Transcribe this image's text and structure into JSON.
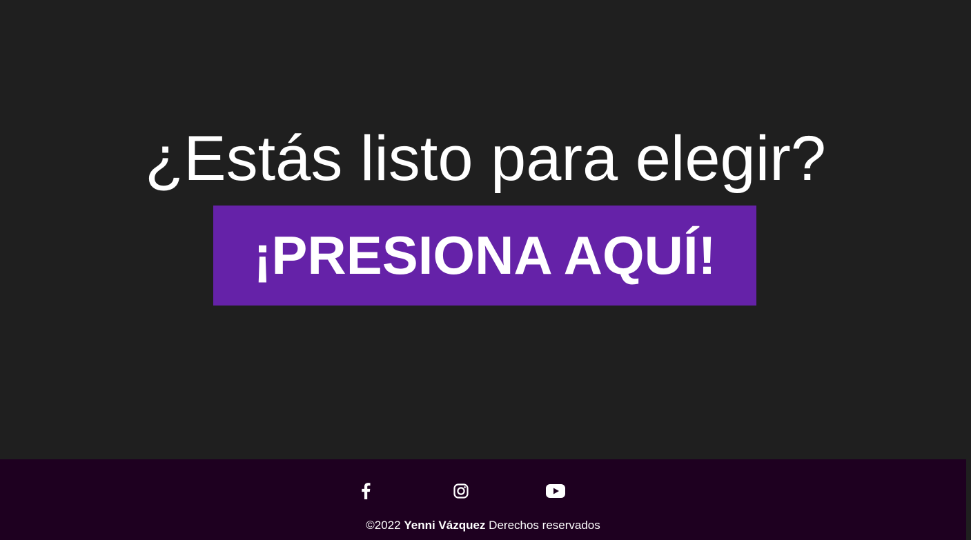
{
  "hero": {
    "headline": "¿Estás listo para elegir?",
    "cta_label": "¡PRESIONA AQUÍ!"
  },
  "footer": {
    "social": [
      {
        "name": "facebook",
        "icon": "facebook-icon"
      },
      {
        "name": "instagram",
        "icon": "instagram-icon"
      },
      {
        "name": "youtube",
        "icon": "youtube-icon"
      }
    ],
    "copyright_prefix": "©2022",
    "copyright_name": "Yenni Vázquez",
    "copyright_suffix": "Derechos reservados"
  },
  "colors": {
    "background": "#1f1f1f",
    "accent": "#6522a8",
    "footer_background": "#1e0020",
    "text": "#ffffff"
  }
}
